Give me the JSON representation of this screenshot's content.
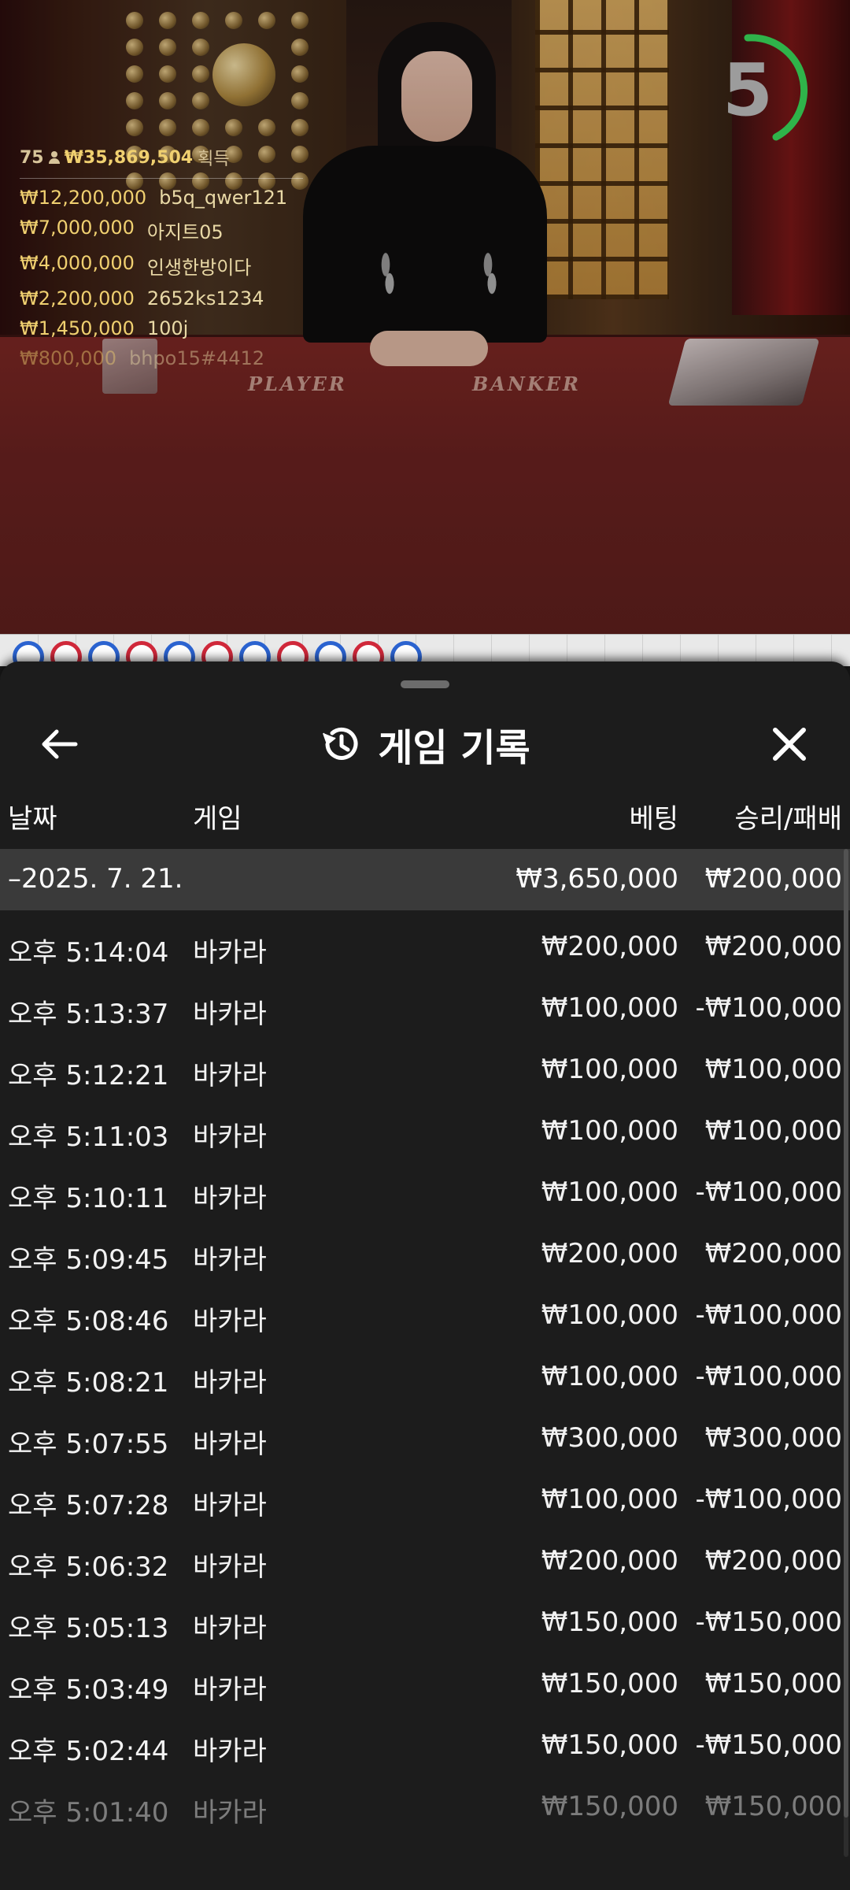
{
  "video": {
    "table_labels": {
      "player": "PLAYER",
      "banker": "BANKER"
    },
    "timer": {
      "value": "5",
      "color": "#2fb34a"
    },
    "leaderboard": {
      "count": "75",
      "total": "₩35,869,504",
      "total_suffix": "획득",
      "entries": [
        {
          "amount": "₩12,200,000",
          "name": "b5q_qwer121"
        },
        {
          "amount": "₩7,000,000",
          "name": "아지트05"
        },
        {
          "amount": "₩4,000,000",
          "name": "인생한방이다"
        },
        {
          "amount": "₩2,200,000",
          "name": "2652ks1234"
        },
        {
          "amount": "₩1,450,000",
          "name": "100j"
        },
        {
          "amount": "₩800,000",
          "name": "bhpo15#4412"
        }
      ]
    },
    "roadmap_beads": [
      "blue",
      "red",
      "blue",
      "red",
      "blue",
      "red",
      "blue",
      "red",
      "blue",
      "red",
      "blue"
    ]
  },
  "sheet": {
    "title": "게임 기록",
    "columns": {
      "date": "날짜",
      "game": "게임",
      "bet": "베팅",
      "winloss": "승리/패배"
    },
    "date_group": {
      "label": "–2025. 7. 21.",
      "bet_total": "₩3,650,000",
      "winloss_total": "₩200,000"
    },
    "rows": [
      {
        "time": "오후 5:14:04",
        "game": "바카라",
        "bet": "₩200,000",
        "winloss": "₩200,000"
      },
      {
        "time": "오후 5:13:37",
        "game": "바카라",
        "bet": "₩100,000",
        "winloss": "-₩100,000"
      },
      {
        "time": "오후 5:12:21",
        "game": "바카라",
        "bet": "₩100,000",
        "winloss": "₩100,000"
      },
      {
        "time": "오후 5:11:03",
        "game": "바카라",
        "bet": "₩100,000",
        "winloss": "₩100,000"
      },
      {
        "time": "오후 5:10:11",
        "game": "바카라",
        "bet": "₩100,000",
        "winloss": "-₩100,000"
      },
      {
        "time": "오후 5:09:45",
        "game": "바카라",
        "bet": "₩200,000",
        "winloss": "₩200,000"
      },
      {
        "time": "오후 5:08:46",
        "game": "바카라",
        "bet": "₩100,000",
        "winloss": "-₩100,000"
      },
      {
        "time": "오후 5:08:21",
        "game": "바카라",
        "bet": "₩100,000",
        "winloss": "-₩100,000"
      },
      {
        "time": "오후 5:07:55",
        "game": "바카라",
        "bet": "₩300,000",
        "winloss": "₩300,000"
      },
      {
        "time": "오후 5:07:28",
        "game": "바카라",
        "bet": "₩100,000",
        "winloss": "-₩100,000"
      },
      {
        "time": "오후 5:06:32",
        "game": "바카라",
        "bet": "₩200,000",
        "winloss": "₩200,000"
      },
      {
        "time": "오후 5:05:13",
        "game": "바카라",
        "bet": "₩150,000",
        "winloss": "-₩150,000"
      },
      {
        "time": "오후 5:03:49",
        "game": "바카라",
        "bet": "₩150,000",
        "winloss": "₩150,000"
      },
      {
        "time": "오후 5:02:44",
        "game": "바카라",
        "bet": "₩150,000",
        "winloss": "-₩150,000"
      },
      {
        "time": "오후 5:01:40",
        "game": "바카라",
        "bet": "₩150,000",
        "winloss": "₩150,000"
      }
    ]
  },
  "icons": {
    "back": "arrow-left-icon",
    "history": "history-icon",
    "close": "close-icon"
  }
}
